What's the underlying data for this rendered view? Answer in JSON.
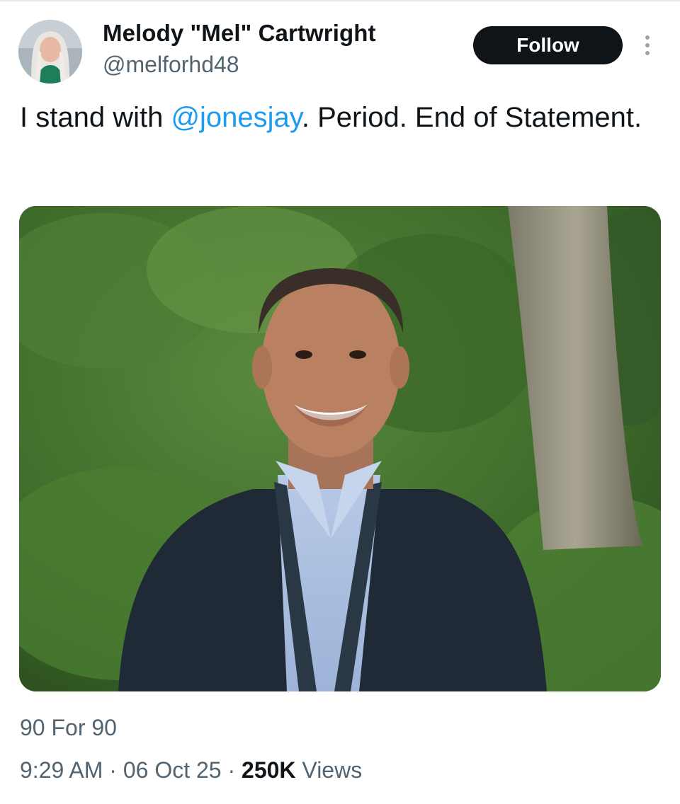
{
  "author": {
    "display_name": "Melody \"Mel\" Cartwright",
    "handle": "@melforhd48"
  },
  "actions": {
    "follow_label": "Follow"
  },
  "tweet": {
    "text_before": "I stand with ",
    "mention": "@jonesjay",
    "text_after": ". Period. End of Statement."
  },
  "media": {
    "description_icon": "photo"
  },
  "source": "90 For 90",
  "meta": {
    "time": "9:29 AM",
    "separator": "·",
    "date": "06 Oct 25",
    "views_count": "250K",
    "views_label": "Views"
  },
  "colors": {
    "accent": "#1d9bf0",
    "button_bg": "#0f1419",
    "secondary_text": "#536471"
  }
}
